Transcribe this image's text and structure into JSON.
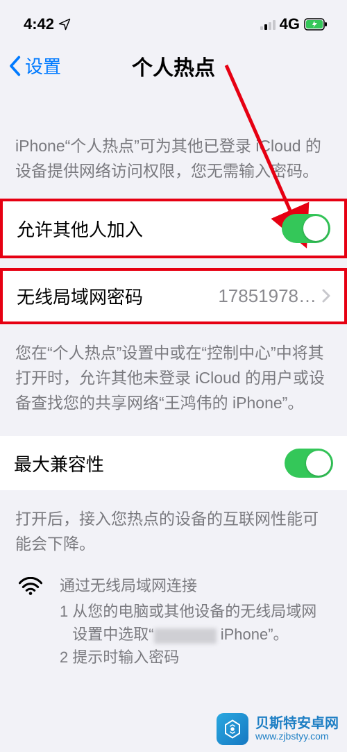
{
  "status": {
    "time": "4:42",
    "network": "4G"
  },
  "nav": {
    "back": "设置",
    "title": "个人热点"
  },
  "section1": {
    "description": "iPhone“个人热点”可为其他已登录 iCloud 的设备提供网络访问权限，您无需输入密码。",
    "allow_others": {
      "label": "允许其他人加入"
    },
    "password": {
      "label": "无线局域网密码",
      "value": "17851978…"
    },
    "footer": "您在“个人热点”设置中或在“控制中心”中将其打开时，允许其他未登录 iCloud 的用户或设备查找您的共享网络“王鸿伟的 iPhone”。"
  },
  "section2": {
    "compat": {
      "label": "最大兼容性"
    },
    "footer": "打开后，接入您热点的设备的互联网性能可能会下降。",
    "wifi_help": {
      "title": "通过无线局域网连接",
      "step1_prefix": "从您的电脑或其他设备的无线局域网设置中选取“",
      "step1_suffix": " iPhone”。",
      "step2": "提示时输入密码"
    }
  },
  "watermark": {
    "name": "贝斯特安卓网",
    "url": "www.zjbstyy.com"
  }
}
